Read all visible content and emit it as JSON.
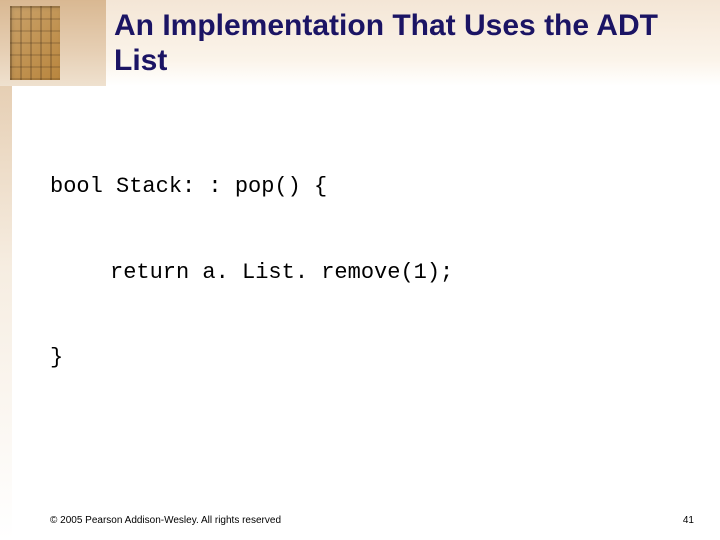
{
  "title": "An Implementation That Uses the ADT List",
  "code": {
    "line1": "bool Stack: : pop() {",
    "line2": "return a. List. remove(1);",
    "line3": "}"
  },
  "footer": {
    "copyright": "© 2005 Pearson Addison-Wesley. All rights reserved",
    "page": "41"
  }
}
